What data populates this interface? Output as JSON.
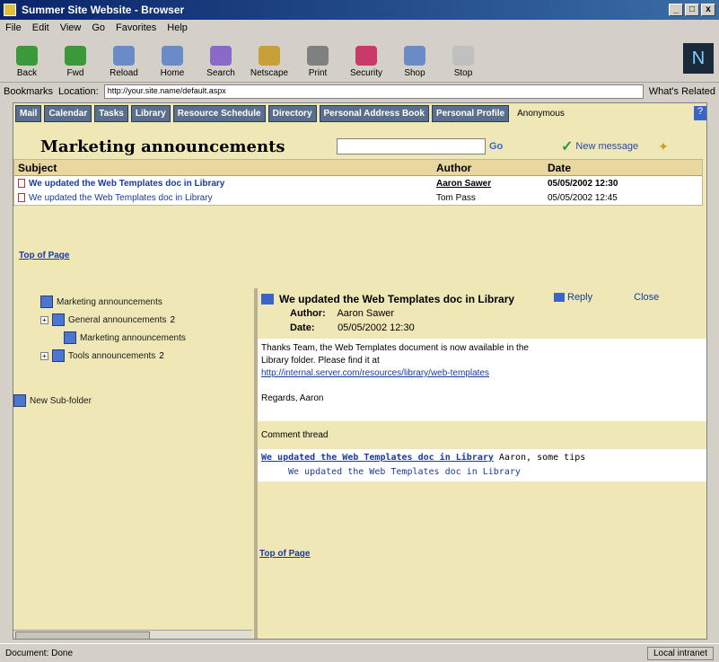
{
  "window": {
    "title": "Summer Site Website - Browser",
    "min": "_",
    "max": "□",
    "close": "x"
  },
  "menu": [
    "File",
    "Edit",
    "View",
    "Go",
    "Favorites",
    "Help"
  ],
  "toolbar": {
    "buttons": [
      {
        "label": "Back",
        "color": "#3a9a3a"
      },
      {
        "label": "Fwd",
        "color": "#3a9a3a"
      },
      {
        "label": "Reload",
        "color": "#6a8ac8"
      },
      {
        "label": "Home",
        "color": "#6a8ac8"
      },
      {
        "label": "Search",
        "color": "#8a6ac8"
      },
      {
        "label": "Netscape",
        "color": "#c8a03a"
      },
      {
        "label": "Print",
        "color": "#808080"
      },
      {
        "label": "Security",
        "color": "#c83a6a"
      },
      {
        "label": "Shop",
        "color": "#6a8ac8"
      },
      {
        "label": "Stop",
        "color": "#c0c0c0"
      }
    ]
  },
  "address": {
    "bookmarks": "Bookmarks",
    "location_label": "Location:",
    "url": "http://your.site.name/default.aspx",
    "related": "What's Related"
  },
  "nav": {
    "tabs": [
      "Mail",
      "Calendar",
      "Tasks",
      "Library",
      "Resource Schedule",
      "Directory",
      "Personal Address Book",
      "Personal Profile"
    ],
    "user": "Anonymous",
    "help": "?"
  },
  "folder": {
    "title": "Marketing announcements",
    "search_go": "Go",
    "new_message": "New message"
  },
  "list": {
    "columns": {
      "subject": "Subject",
      "author": "Author",
      "date": "Date"
    },
    "rows": [
      {
        "subject": "We updated the Web Templates doc in Library",
        "author": "Aaron Sawer",
        "date": "05/05/2002 12:30"
      },
      {
        "subject": "We updated the Web Templates doc in Library",
        "author": "Tom Pass",
        "date": "05/05/2002 12:45"
      }
    ]
  },
  "top_link": "Top of Page",
  "tree": [
    {
      "label": "Marketing announcements",
      "expander": ""
    },
    {
      "label": "General announcements",
      "count": "2",
      "expander": "+"
    },
    {
      "label": "Marketing announcements",
      "expander": ""
    },
    {
      "label": "Tools announcements",
      "count": "2",
      "expander": "+"
    }
  ],
  "new_folder": "New Sub-folder",
  "message": {
    "subject": "We updated the Web Templates doc in Library",
    "reply": "Reply",
    "close": "Close",
    "author_label": "Author:",
    "author": "Aaron Sawer",
    "date_label": "Date:",
    "date": "05/05/2002 12:30",
    "body_line1": "Thanks Team, the Web Templates document is now available in the",
    "body_line2": "Library folder. Please find it at",
    "body_url": "http://internal.server.com/resources/library/web-templates",
    "signature": "Regards, Aaron",
    "comments_label": "Comment thread",
    "thread_link": "We updated the Web Templates doc in Library",
    "thread_tail": "Aaron, some tips",
    "thread_reply": "We updated the Web Templates doc in Library"
  },
  "bottom_link": "Top of Page",
  "status": {
    "text": "Document: Done",
    "zone": "Local intranet"
  }
}
